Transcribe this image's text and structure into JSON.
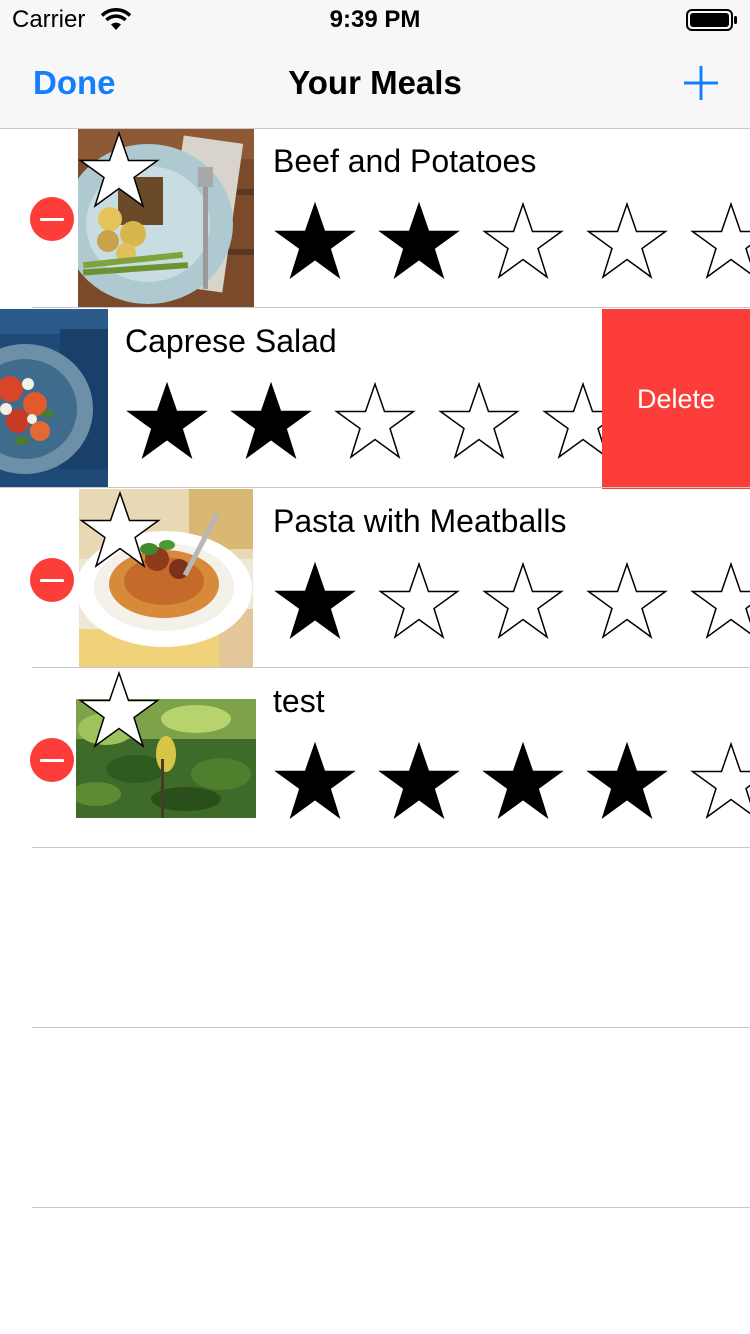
{
  "status_bar": {
    "carrier": "Carrier",
    "time": "9:39 PM",
    "icons": [
      "wifi-icon",
      "battery-icon"
    ]
  },
  "nav": {
    "left_button": "Done",
    "title": "Your Meals",
    "right_icon": "add-icon"
  },
  "accent_color": "#157efb",
  "delete_color": "#fc3d39",
  "meals": [
    {
      "name": "Beef and Potatoes",
      "rating": 2,
      "max_rating": 5,
      "photo": "beef-potatoes-photo",
      "state": "editing"
    },
    {
      "name": "Caprese Salad",
      "rating": 2,
      "max_rating": 5,
      "photo": "caprese-salad-photo",
      "state": "swiped",
      "action_label": "Delete"
    },
    {
      "name": "Pasta with Meatballs",
      "rating": 1,
      "max_rating": 5,
      "photo": "pasta-photo",
      "state": "editing"
    },
    {
      "name": "test",
      "rating": 4,
      "max_rating": 5,
      "photo": "green-plant-photo",
      "state": "editing"
    }
  ]
}
